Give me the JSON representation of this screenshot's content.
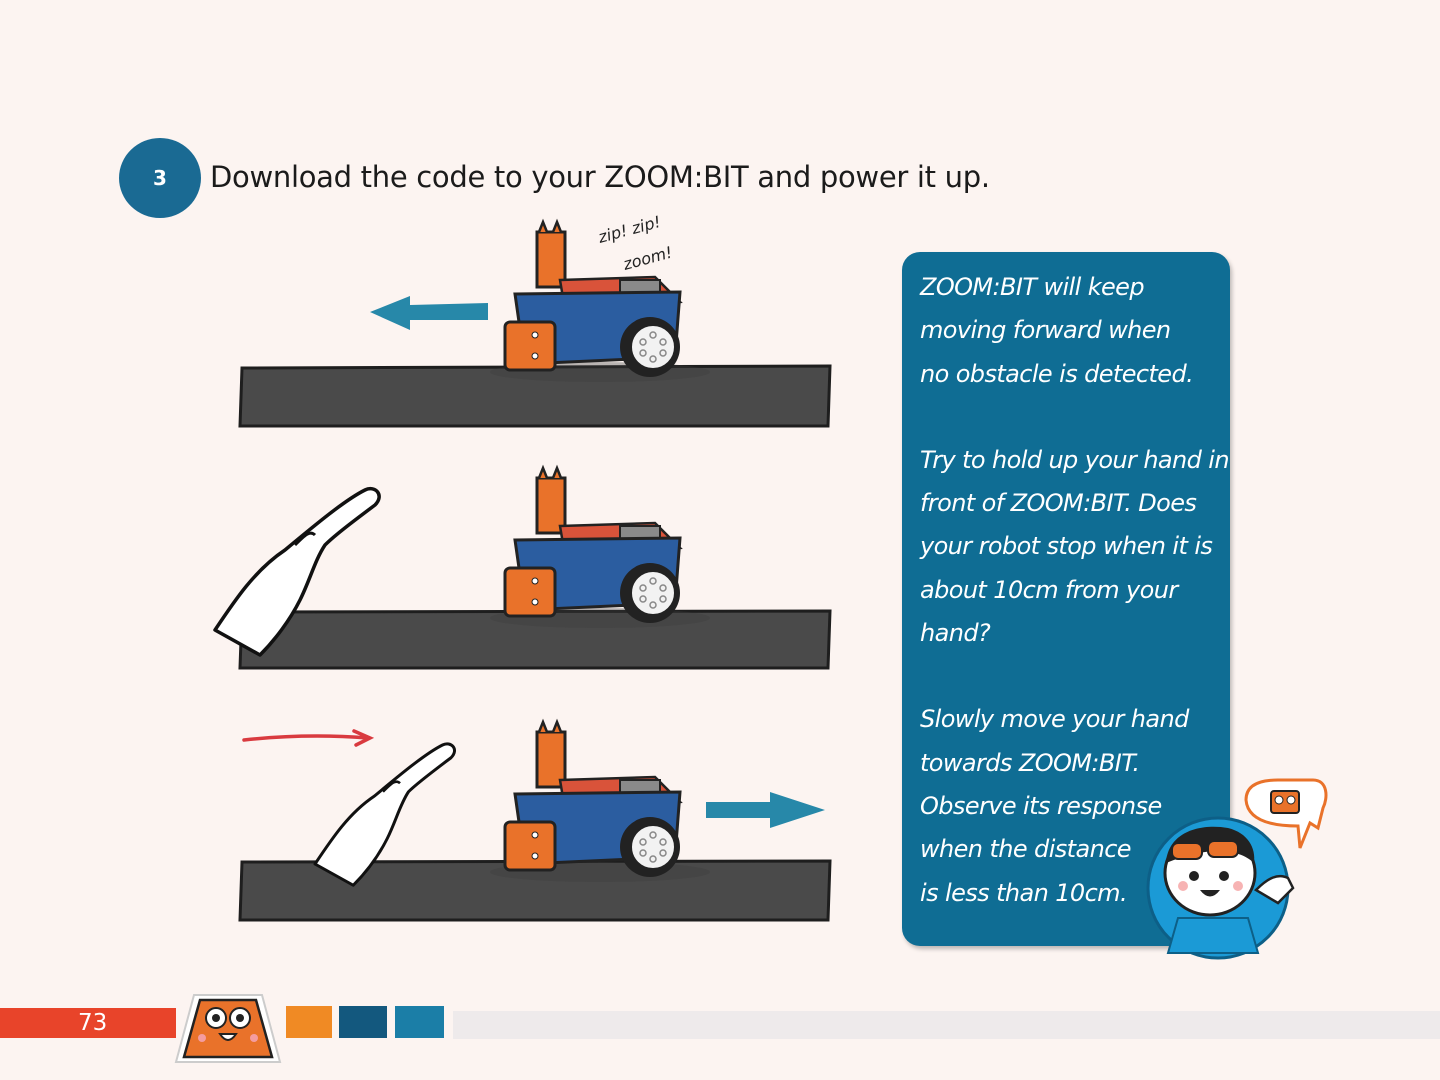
{
  "step": {
    "number": "3",
    "instruction": "Download the code to your ZOOM:BIT and power it up."
  },
  "illustration": {
    "sound_effect_line1": "zip! zip!",
    "sound_effect_line2": "zoom!",
    "panels": [
      "robot-moving-left",
      "hand-in-front-robot-stopped",
      "hand-moving-robot-reversing"
    ]
  },
  "info_box": {
    "paragraph1": [
      "ZOOM:BIT will keep",
      "moving forward when",
      "no obstacle is detected."
    ],
    "paragraph2": [
      "Try to hold up your hand in",
      "front of ZOOM:BIT. Does",
      "your robot stop when it is",
      "about 10cm from your",
      "hand?"
    ],
    "paragraph3": [
      "Slowly move your hand",
      "towards ZOOM:BIT.",
      "Observe its response",
      "when the distance",
      "is less than 10cm."
    ]
  },
  "footer": {
    "page_number": "73"
  },
  "colors": {
    "background": "#fcf4f1",
    "accent_blue": "#1a6a93",
    "info_box": "#0f6d94",
    "footer_red": "#e8442a",
    "footer_orange": "#f08a24",
    "footer_dark_blue": "#13587e",
    "footer_blue": "#1b7ea7",
    "robot_body": "#2b5da0",
    "robot_orange": "#e9722a",
    "road": "#4a4a4a",
    "arrow": "#2788a9",
    "red_arrow": "#d93a3f"
  }
}
